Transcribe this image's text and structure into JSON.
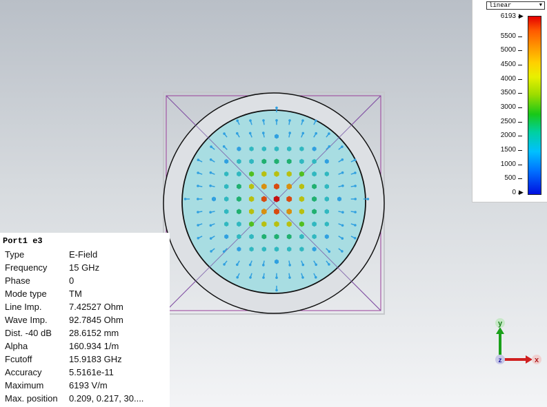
{
  "colorbar": {
    "scale": "linear",
    "labels": [
      "6193",
      "5500",
      "5000",
      "4500",
      "4000",
      "3500",
      "3000",
      "2500",
      "2000",
      "1500",
      "1000",
      "500",
      "0"
    ],
    "max": 6193,
    "min": 0
  },
  "info": {
    "title": "Port1 e3",
    "rows": [
      {
        "key": "Type",
        "value": "E-Field"
      },
      {
        "key": "Frequency",
        "value": "15 GHz"
      },
      {
        "key": "Phase",
        "value": "0"
      },
      {
        "key": "Mode type",
        "value": "TM"
      },
      {
        "key": "Line Imp.",
        "value": "7.42527 Ohm"
      },
      {
        "key": "Wave Imp.",
        "value": "92.7845 Ohm"
      },
      {
        "key": "Dist. -40 dB",
        "value": "28.6152 mm"
      },
      {
        "key": "Alpha",
        "value": "160.934 1/m"
      },
      {
        "key": "Fcutoff",
        "value": "15.9183 GHz"
      },
      {
        "key": "Accuracy",
        "value": "5.5161e-11"
      },
      {
        "key": "Maximum",
        "value": "6193 V/m"
      },
      {
        "key": "Max. position",
        "value": "0.209,    0.217,    30...."
      }
    ]
  },
  "axes": {
    "y": "y",
    "x": "x",
    "z": "z"
  },
  "colors": {
    "hot": "#c41010",
    "warm": "#e0a010",
    "mid": "#50c020",
    "cool": "#30c0c0",
    "edge": "#30a0e0",
    "boundary": "#9a3d9a"
  }
}
